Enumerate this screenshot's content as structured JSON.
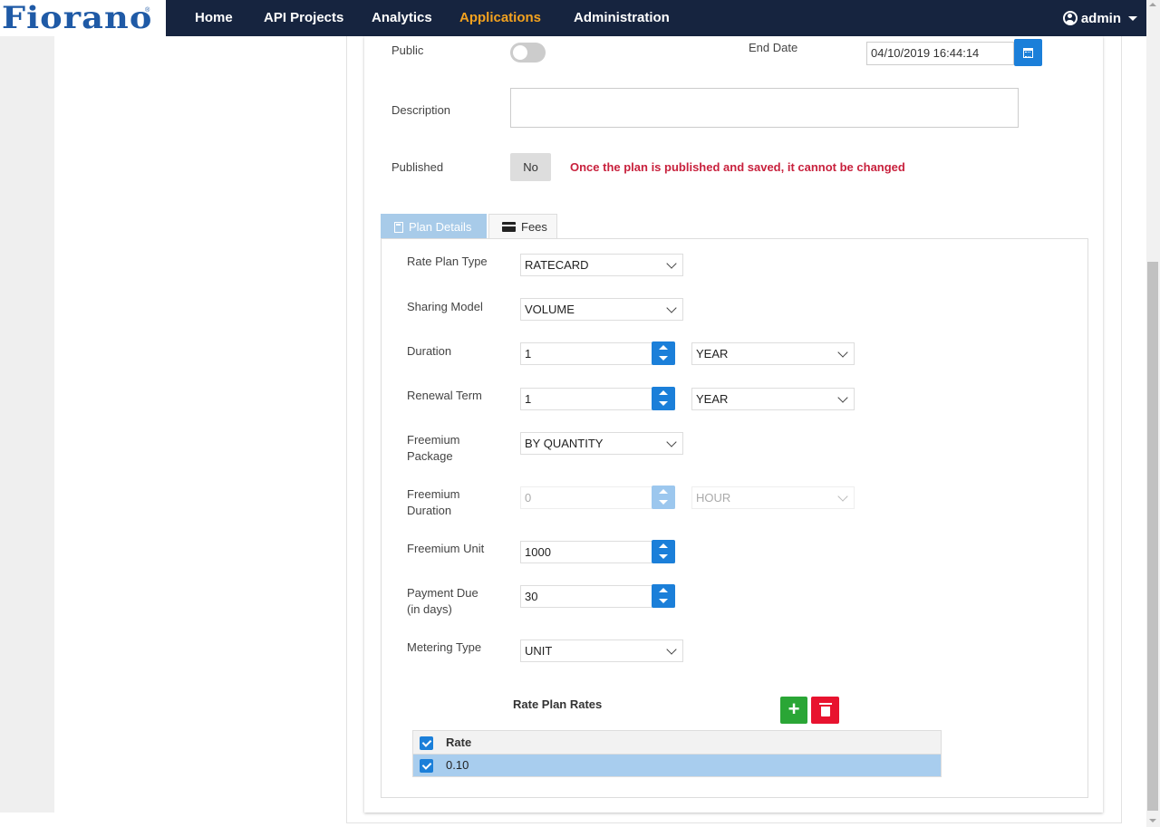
{
  "brand": {
    "logo_text": "Fiorano",
    "logo_mark": "®"
  },
  "nav": {
    "items": [
      {
        "label": "Home"
      },
      {
        "label": "API Projects"
      },
      {
        "label": "Analytics"
      },
      {
        "label": "Applications"
      },
      {
        "label": "Administration"
      }
    ],
    "active": "Applications",
    "user": "admin"
  },
  "form": {
    "public_label": "Public",
    "public_value": false,
    "end_date_label": "End Date",
    "end_date_value": "04/10/2019 16:44:14",
    "description_label": "Description",
    "description_value": "",
    "published_label": "Published",
    "published_value": "No",
    "published_warning": "Once the plan is published and saved, it cannot be changed"
  },
  "tabs": [
    {
      "label": "Plan Details",
      "icon": "calculator-icon",
      "active": true
    },
    {
      "label": "Fees",
      "icon": "credit-card-icon",
      "active": false
    }
  ],
  "plan_details": {
    "rate_plan_type": {
      "label": "Rate Plan Type",
      "value": "RATECARD"
    },
    "sharing_model": {
      "label": "Sharing Model",
      "value": "VOLUME"
    },
    "duration": {
      "label": "Duration",
      "value": "1",
      "unit": "YEAR"
    },
    "renewal_term": {
      "label": "Renewal Term",
      "value": "1",
      "unit": "YEAR"
    },
    "freemium_package": {
      "label_line1": "Freemium",
      "label_line2": "Package",
      "value": "BY QUANTITY"
    },
    "freemium_duration": {
      "label_line1": "Freemium",
      "label_line2": "Duration",
      "value": "0",
      "unit": "HOUR",
      "disabled": true
    },
    "freemium_unit": {
      "label": "Freemium Unit",
      "value": "1000"
    },
    "payment_due": {
      "label_line1": "Payment Due",
      "label_line2": "(in days)",
      "value": "30"
    },
    "metering_type": {
      "label": "Metering Type",
      "value": "UNIT"
    }
  },
  "rates": {
    "title": "Rate Plan Rates",
    "add_label": "+",
    "column": "Rate",
    "rows": [
      {
        "rate": "0.10",
        "checked": true
      }
    ]
  },
  "colors": {
    "navbar": "#16243f",
    "nav_active": "#f3a21f",
    "primary": "#1b7fd9",
    "success": "#2aa636",
    "danger": "#e8132f",
    "warning_text": "#c8213d",
    "selected_row": "#a8cdee"
  }
}
